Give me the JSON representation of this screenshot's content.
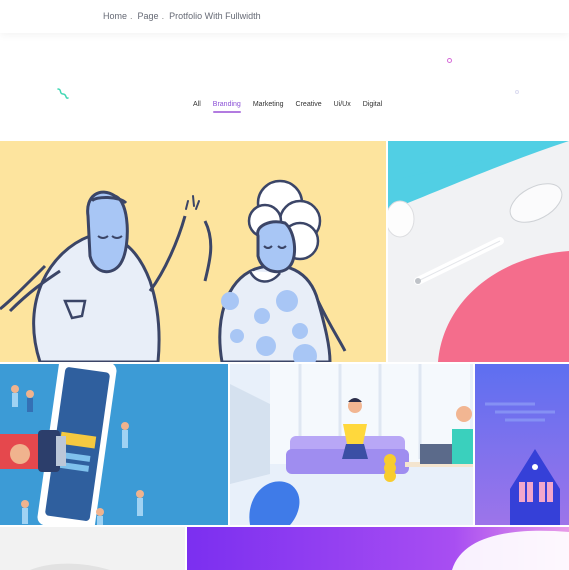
{
  "breadcrumb": {
    "items": [
      "Home",
      "Page",
      "Protfolio With Fullwidth"
    ],
    "separator": "."
  },
  "filters": {
    "items": [
      "All",
      "Branding",
      "Marketing",
      "Creative",
      "Ui/Ux",
      "Digital"
    ],
    "active": "Branding"
  },
  "portfolio": {
    "tiles": [
      {
        "name": "high-five-illustration"
      },
      {
        "name": "mouse-and-pen-photo"
      },
      {
        "name": "mobile-marketing-illustration"
      },
      {
        "name": "workspace-illustration"
      },
      {
        "name": "house-illustration"
      },
      {
        "name": "gray-photo"
      },
      {
        "name": "purple-gradient-artwork"
      }
    ]
  },
  "colors": {
    "accent": "#8a4fd6",
    "tile_yellow": "#fde49e",
    "tile_cyan": "#51cfe4",
    "tile_blue": "#3c9bd6",
    "tile_purple": "#6c6be6"
  }
}
